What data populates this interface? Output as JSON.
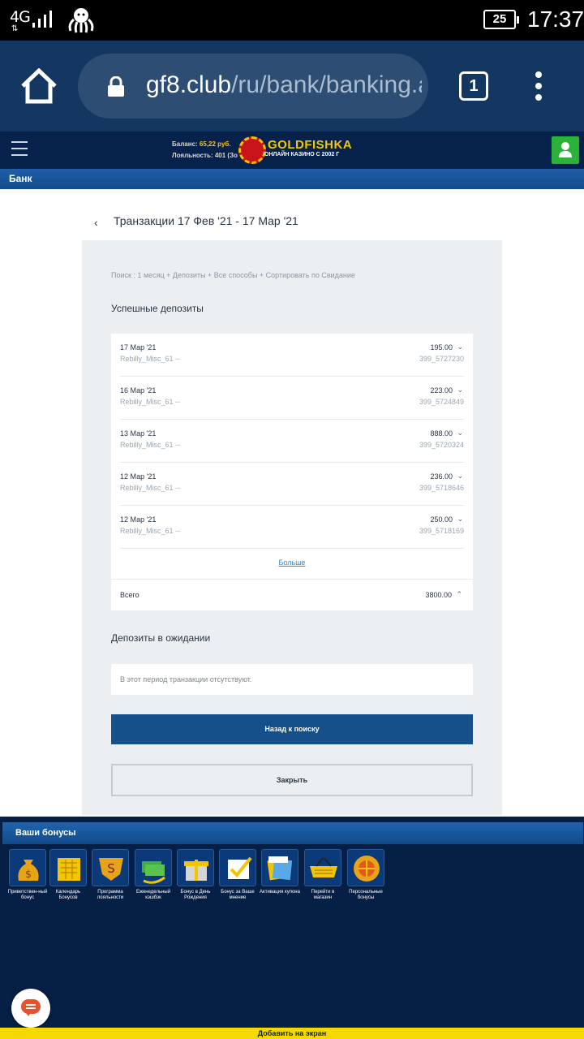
{
  "status_bar": {
    "network": "4G",
    "battery": "25",
    "time": "17:37"
  },
  "browser": {
    "url_host": "gf8.club",
    "url_path": "/ru/bank/banking.a",
    "tab_count": "1"
  },
  "site_header": {
    "balance_label": "Баланс:",
    "balance_value": "65,22 руб.",
    "loyalty_text": "Лояльность: 401 (Зо",
    "logo_text": "GOLDFISHKA",
    "logo_subtitle": "ОНЛАЙН КАЗИНО С 2002 Г"
  },
  "bank_bar": {
    "title": "Банк"
  },
  "transactions": {
    "title": "Транзакции 17 Фев '21 - 17 Мар '21",
    "search_summary": "Поиск : 1 месяц + Депозиты + Все способы + Сортировать по Свидание",
    "success_heading": "Успешные депозиты",
    "rows": [
      {
        "date": "17 Мар '21",
        "method": "Rebilly_Misc_61 --",
        "amount": "195.00",
        "ref": "399_5727230"
      },
      {
        "date": "16 Мар '21",
        "method": "Rebilly_Misc_61 --",
        "amount": "223.00",
        "ref": "399_5724849"
      },
      {
        "date": "13 Мар '21",
        "method": "Rebilly_Misc_61 --",
        "amount": "888.00",
        "ref": "399_5720324"
      },
      {
        "date": "12 Мар '21",
        "method": "Rebilly_Misc_61 --",
        "amount": "236.00",
        "ref": "399_5718646"
      },
      {
        "date": "12 Мар '21",
        "method": "Rebilly_Misc_61 --",
        "amount": "250.00",
        "ref": "399_5718169"
      }
    ],
    "more_link": "Больше",
    "total_label": "Всего",
    "total_amount": "3800.00",
    "pending_heading": "Депозиты в ожидании",
    "pending_empty": "В этот период транзакции отсутствуют.",
    "back_button": "Назад к поиску",
    "close_button": "Закрыть"
  },
  "bonuses": {
    "heading": "Ваши бонусы",
    "items": [
      {
        "label": "Приветствен-ный бонус",
        "icon": "money-bag-icon"
      },
      {
        "label": "Календарь Бонусов",
        "icon": "calendar-icon"
      },
      {
        "label": "Программа лояльности",
        "icon": "loyalty-shield-icon"
      },
      {
        "label": "Еженедельный кэшбэк",
        "icon": "cashback-icon"
      },
      {
        "label": "Бонус в День Рождения",
        "icon": "gift-icon"
      },
      {
        "label": "Бонус за Ваше мнение",
        "icon": "checkbox-icon"
      },
      {
        "label": "Активация купона",
        "icon": "coupon-icon"
      },
      {
        "label": "Перейти в магазин",
        "icon": "shop-basket-icon"
      },
      {
        "label": "Персональные бонусы",
        "icon": "personal-bonus-icon"
      }
    ]
  },
  "add_to_screen": "Добавить на экран"
}
